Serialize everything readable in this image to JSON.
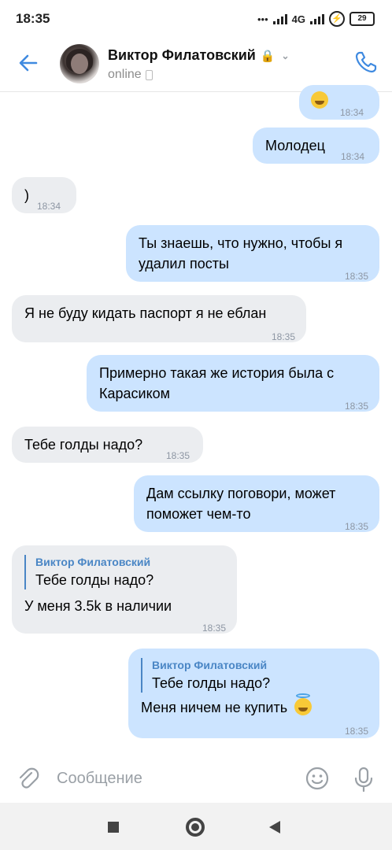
{
  "status_bar": {
    "time": "18:35",
    "network": "4G",
    "battery": "29"
  },
  "header": {
    "contact_name": "Виктор Филатовский",
    "contact_status": "online",
    "badge_icon": "🔒"
  },
  "messages": [
    {
      "dir": "out",
      "text": "",
      "time": "18:34",
      "emoji": "laughing"
    },
    {
      "dir": "out",
      "text": "Молодец",
      "time": "18:34"
    },
    {
      "dir": "in",
      "text": ")",
      "time": "18:34"
    },
    {
      "dir": "out",
      "text": "Ты знаешь, что нужно, чтобы я удалил посты",
      "time": "18:35"
    },
    {
      "dir": "in",
      "text": "Я не буду кидать паспорт я не еблан",
      "time": "18:35"
    },
    {
      "dir": "out",
      "text": "Примерно такая же история была с Карасиком",
      "time": "18:35"
    },
    {
      "dir": "in",
      "text": "Тебе голды надо?",
      "time": "18:35"
    },
    {
      "dir": "out",
      "text": "Дам ссылку поговори, может поможет чем-то",
      "time": "18:35"
    },
    {
      "dir": "in",
      "reply_name": "Виктор Филатовский",
      "reply_text": "Тебе голды надо?",
      "text": "У меня 3.5k в наличии",
      "time": "18:35"
    },
    {
      "dir": "out",
      "reply_name": "Виктор Филатовский",
      "reply_text": "Тебе голды надо?",
      "text": "Меня ничем не купить",
      "time": "18:35",
      "emoji": "innocent"
    }
  ],
  "composer": {
    "placeholder": "Сообщение"
  },
  "icons": {
    "back": "arrow-left-icon",
    "call": "phone-icon",
    "attach": "paperclip-icon",
    "sticker": "smiley-icon",
    "voice": "microphone-icon"
  },
  "colors": {
    "accent": "#3f8ae0",
    "outgoing_bubble": "#cce4ff",
    "incoming_bubble": "#ebedf0"
  }
}
